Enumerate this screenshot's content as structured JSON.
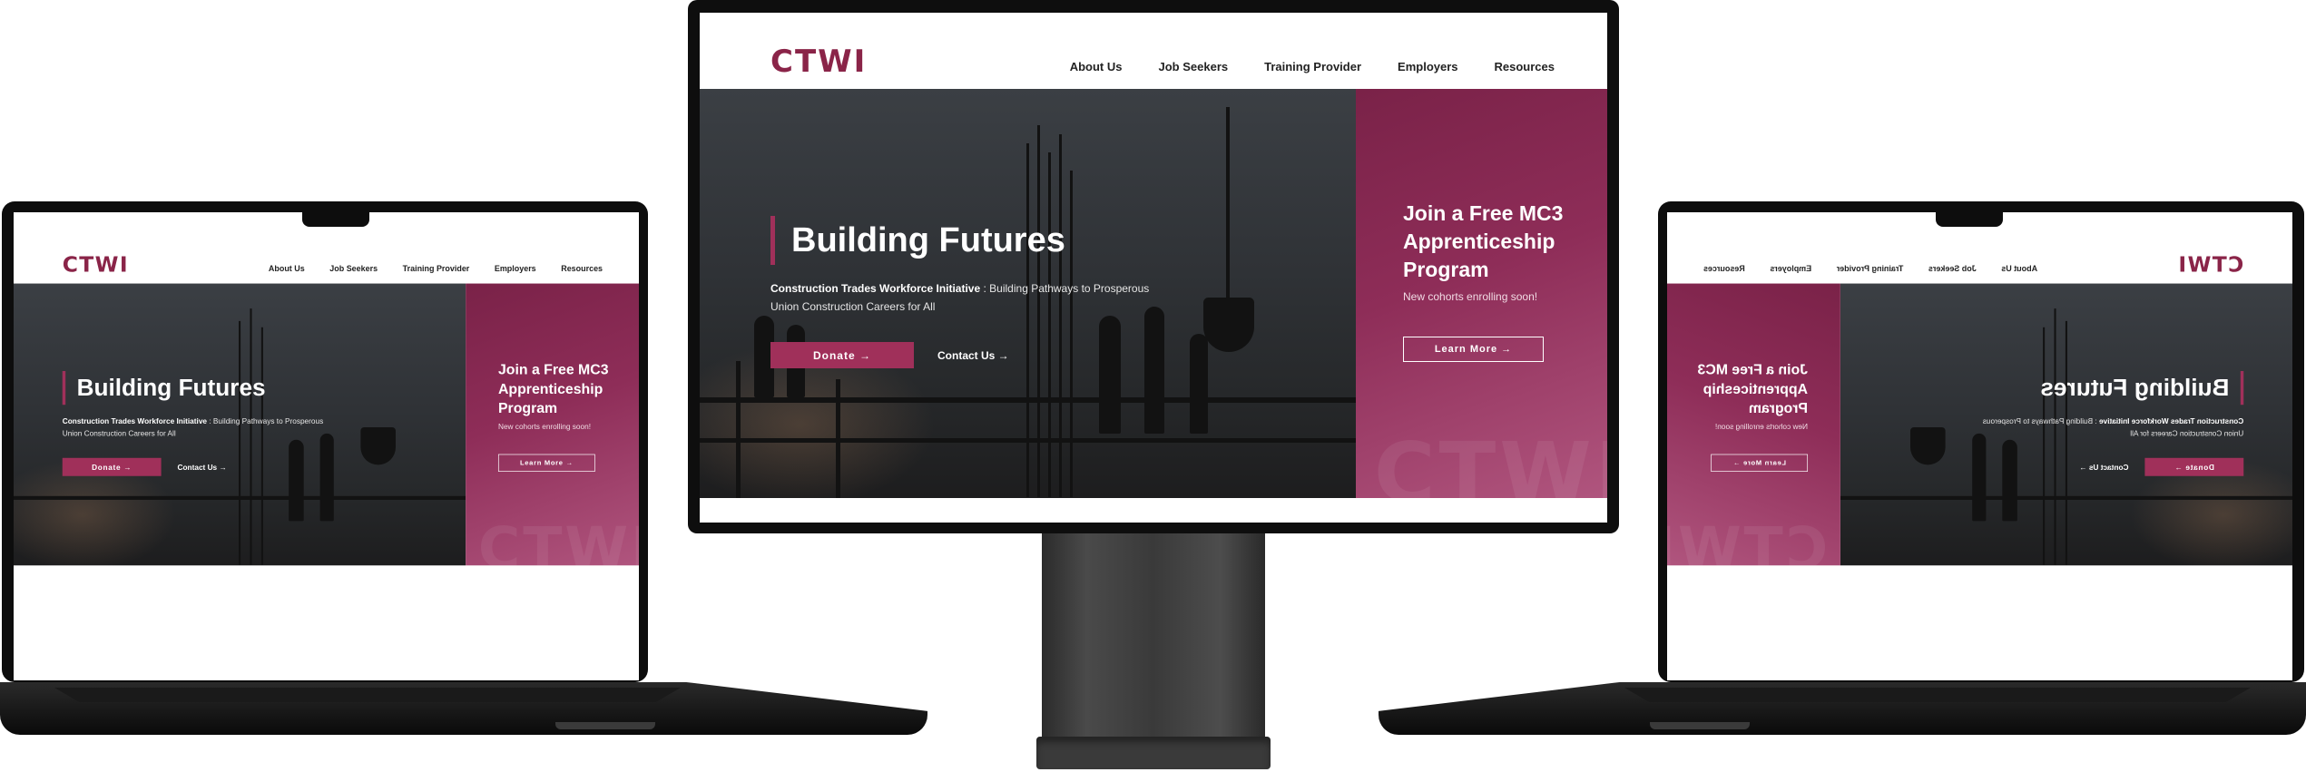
{
  "site": {
    "logo": "CTWI",
    "nav": [
      "About Us",
      "Job Seekers",
      "Training Provider",
      "Employers",
      "Resources"
    ],
    "hero": {
      "title": "Building Futures",
      "subtitle_bold": "Construction Trades Workforce Initiative",
      "subtitle_rest": " : Building Pathways to Prosperous Union Construction Careers for All",
      "donate_label": "Donate →",
      "contact_label": "Contact Us →"
    },
    "promo": {
      "title": "Join a Free MC3 Apprenticeship Program",
      "subtitle": "New cohorts enrolling soon!",
      "learn_label": "Learn More →",
      "watermark": "CTWI"
    }
  },
  "colors": {
    "brand": "#8a2448",
    "accent": "#a0305a",
    "promo_panel": "#8e2d58",
    "device": "#0d0d0d"
  }
}
